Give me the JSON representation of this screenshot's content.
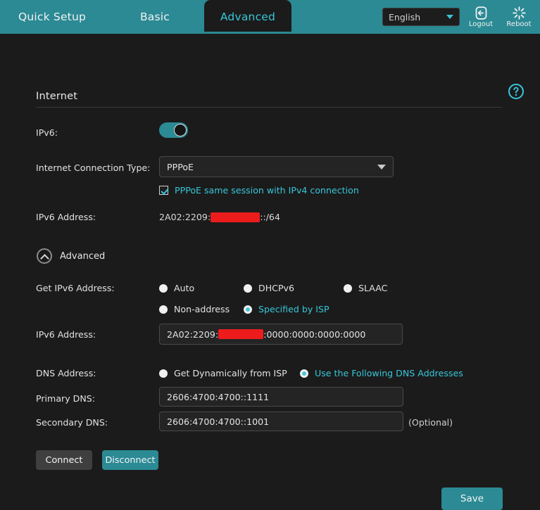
{
  "header": {
    "tabs": [
      {
        "label": "Quick Setup",
        "active": false
      },
      {
        "label": "Basic",
        "active": false
      },
      {
        "label": "Advanced",
        "active": true
      }
    ],
    "language": {
      "value": "English",
      "icon": "chevron-down-icon"
    },
    "logout": {
      "label": "Logout",
      "icon": "logout-icon"
    },
    "reboot": {
      "label": "Reboot",
      "icon": "reboot-icon"
    }
  },
  "help": {
    "icon": "help-circle-icon"
  },
  "section": {
    "title": "Internet"
  },
  "fields": {
    "ipv6_enable": {
      "label": "IPv6:",
      "state": "on"
    },
    "connection_type": {
      "label": "Internet Connection Type:",
      "value": "PPPoE"
    },
    "same_session": {
      "label": "PPPoE same session with IPv4 connection",
      "checked": true
    },
    "ipv6_address_display": {
      "label": "IPv6 Address:",
      "prefix": "2A02:2209:",
      "redacted": true,
      "suffix": "::/64"
    },
    "advanced_toggle": {
      "label": "Advanced",
      "expanded": true,
      "icon": "chevron-up-circle-icon"
    },
    "get_ipv6_address": {
      "label": "Get IPv6 Address:",
      "options": [
        {
          "label": "Auto",
          "selected": false
        },
        {
          "label": "DHCPv6",
          "selected": false
        },
        {
          "label": "SLAAC",
          "selected": false
        },
        {
          "label": "Non-address",
          "selected": false
        },
        {
          "label": "Specified by ISP",
          "selected": true
        }
      ]
    },
    "ipv6_address_input": {
      "label": "IPv6 Address:",
      "prefix": "2A02:2209:",
      "redacted": true,
      "suffix": ":0000:0000:0000:0000"
    },
    "dns_address": {
      "label": "DNS Address:",
      "options": [
        {
          "label": "Get Dynamically from ISP",
          "selected": false
        },
        {
          "label": "Use the Following DNS Addresses",
          "selected": true
        }
      ]
    },
    "primary_dns": {
      "label": "Primary DNS:",
      "value": "2606:4700:4700::1111"
    },
    "secondary_dns": {
      "label": "Secondary DNS:",
      "value": "2606:4700:4700::1001",
      "note": "(Optional)"
    }
  },
  "buttons": {
    "connect": "Connect",
    "disconnect": "Disconnect",
    "save": "Save"
  },
  "colors": {
    "accent": "#2b8a94",
    "accent_text": "#38c6d9",
    "background": "#1b1b1b",
    "redaction": "#ec1c1c"
  }
}
